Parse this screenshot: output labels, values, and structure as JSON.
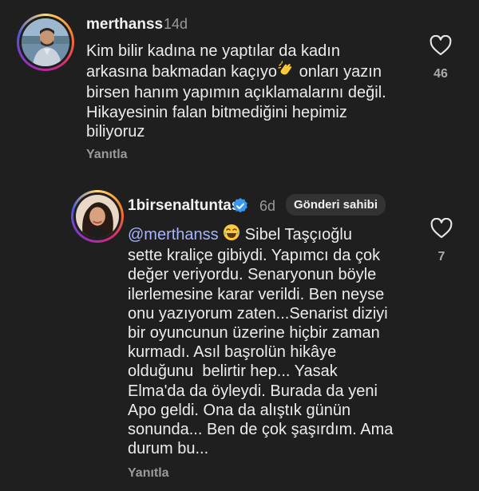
{
  "comments": [
    {
      "username": "merthanss",
      "time": "14d",
      "text_lines": [
        "Kim bilir kadına ne yaptılar da kadın",
        "arkasına bakmadan kaçıyo",
        "birsen hanım yapımın açıklamalarını değil.",
        "Hikayesinin falan bitmediğini hepimiz",
        "biliyoruz"
      ],
      "line2_suffix": " onları yazın",
      "emoji": "clapping-hands",
      "reply_label": "Yanıtla",
      "like_count": "46"
    },
    {
      "username": "1birsenaltuntas",
      "verified": true,
      "time": "6d",
      "owner_badge": "Gönderi sahibi",
      "mention": "@merthanss",
      "emoji": "laughing-face",
      "first_line_rest": " Sibel Taşçıoğlu",
      "text_lines": [
        "sette kraliçe gibiydi. Yapımcı da çok",
        "değer veriyordu. Senaryonun böyle",
        "ilerlemesine karar verildi. Ben neyse",
        "onu yazıyorum zaten...Senarist diziyi",
        "bir oyuncunun üzerine hiçbir zaman",
        "kurmadı. Asıl başrolün hikâye",
        "olduğunu  belirtir hep... Yasak",
        "Elma'da da öyleydi. Burada da yeni",
        "Apo geldi. Ona da alıştık günün",
        "sonunda... Ben de çok şaşırdım. Ama",
        "durum bu..."
      ],
      "reply_label": "Yanıtla",
      "like_count": "7"
    }
  ],
  "colors": {
    "background": "#1f1f1f",
    "mention": "#a7b4ff",
    "verified": "#3897f0",
    "muted": "#9a9a9a"
  },
  "icons": [
    "heart-outline-icon",
    "verified-badge-icon"
  ]
}
